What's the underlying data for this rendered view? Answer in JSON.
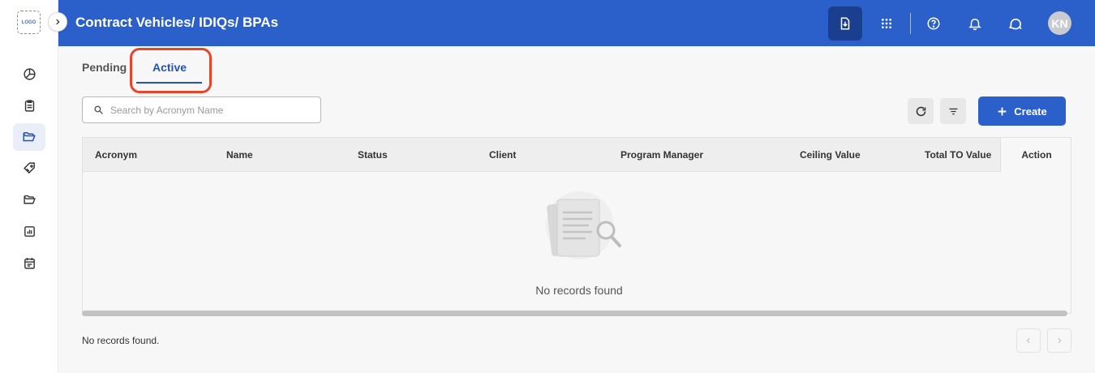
{
  "app": {
    "logo_text": "LOGO",
    "page_title": "Contract Vehicles/ IDIQs/ BPAs",
    "user_initials": "KN",
    "brand_color": "#2b5fc9"
  },
  "sidebar": {
    "items": [
      {
        "icon": "dashboard-pie-icon",
        "active": false
      },
      {
        "icon": "clipboard-icon",
        "active": false
      },
      {
        "icon": "folder-open-icon",
        "active": true
      },
      {
        "icon": "tag-icon",
        "active": false
      },
      {
        "icon": "folder-icon",
        "active": false
      },
      {
        "icon": "report-chart-icon",
        "active": false
      },
      {
        "icon": "calendar-icon",
        "active": false
      }
    ]
  },
  "header_actions": [
    "download-icon",
    "apps-grid-icon",
    "help-icon",
    "bell-icon",
    "chat-icon"
  ],
  "tabs": [
    {
      "label": "Pending",
      "active": false
    },
    {
      "label": "Active",
      "active": true
    }
  ],
  "search": {
    "placeholder": "Search by Acronym Name",
    "value": ""
  },
  "toolbar": {
    "create_label": "Create"
  },
  "table": {
    "columns": [
      "Acronym",
      "Name",
      "Status",
      "Client",
      "Program Manager",
      "Ceiling Value",
      "Total TO Value",
      "Action"
    ],
    "rows": [],
    "empty_message": "No records found"
  },
  "footer": {
    "status_text": "No records found."
  }
}
